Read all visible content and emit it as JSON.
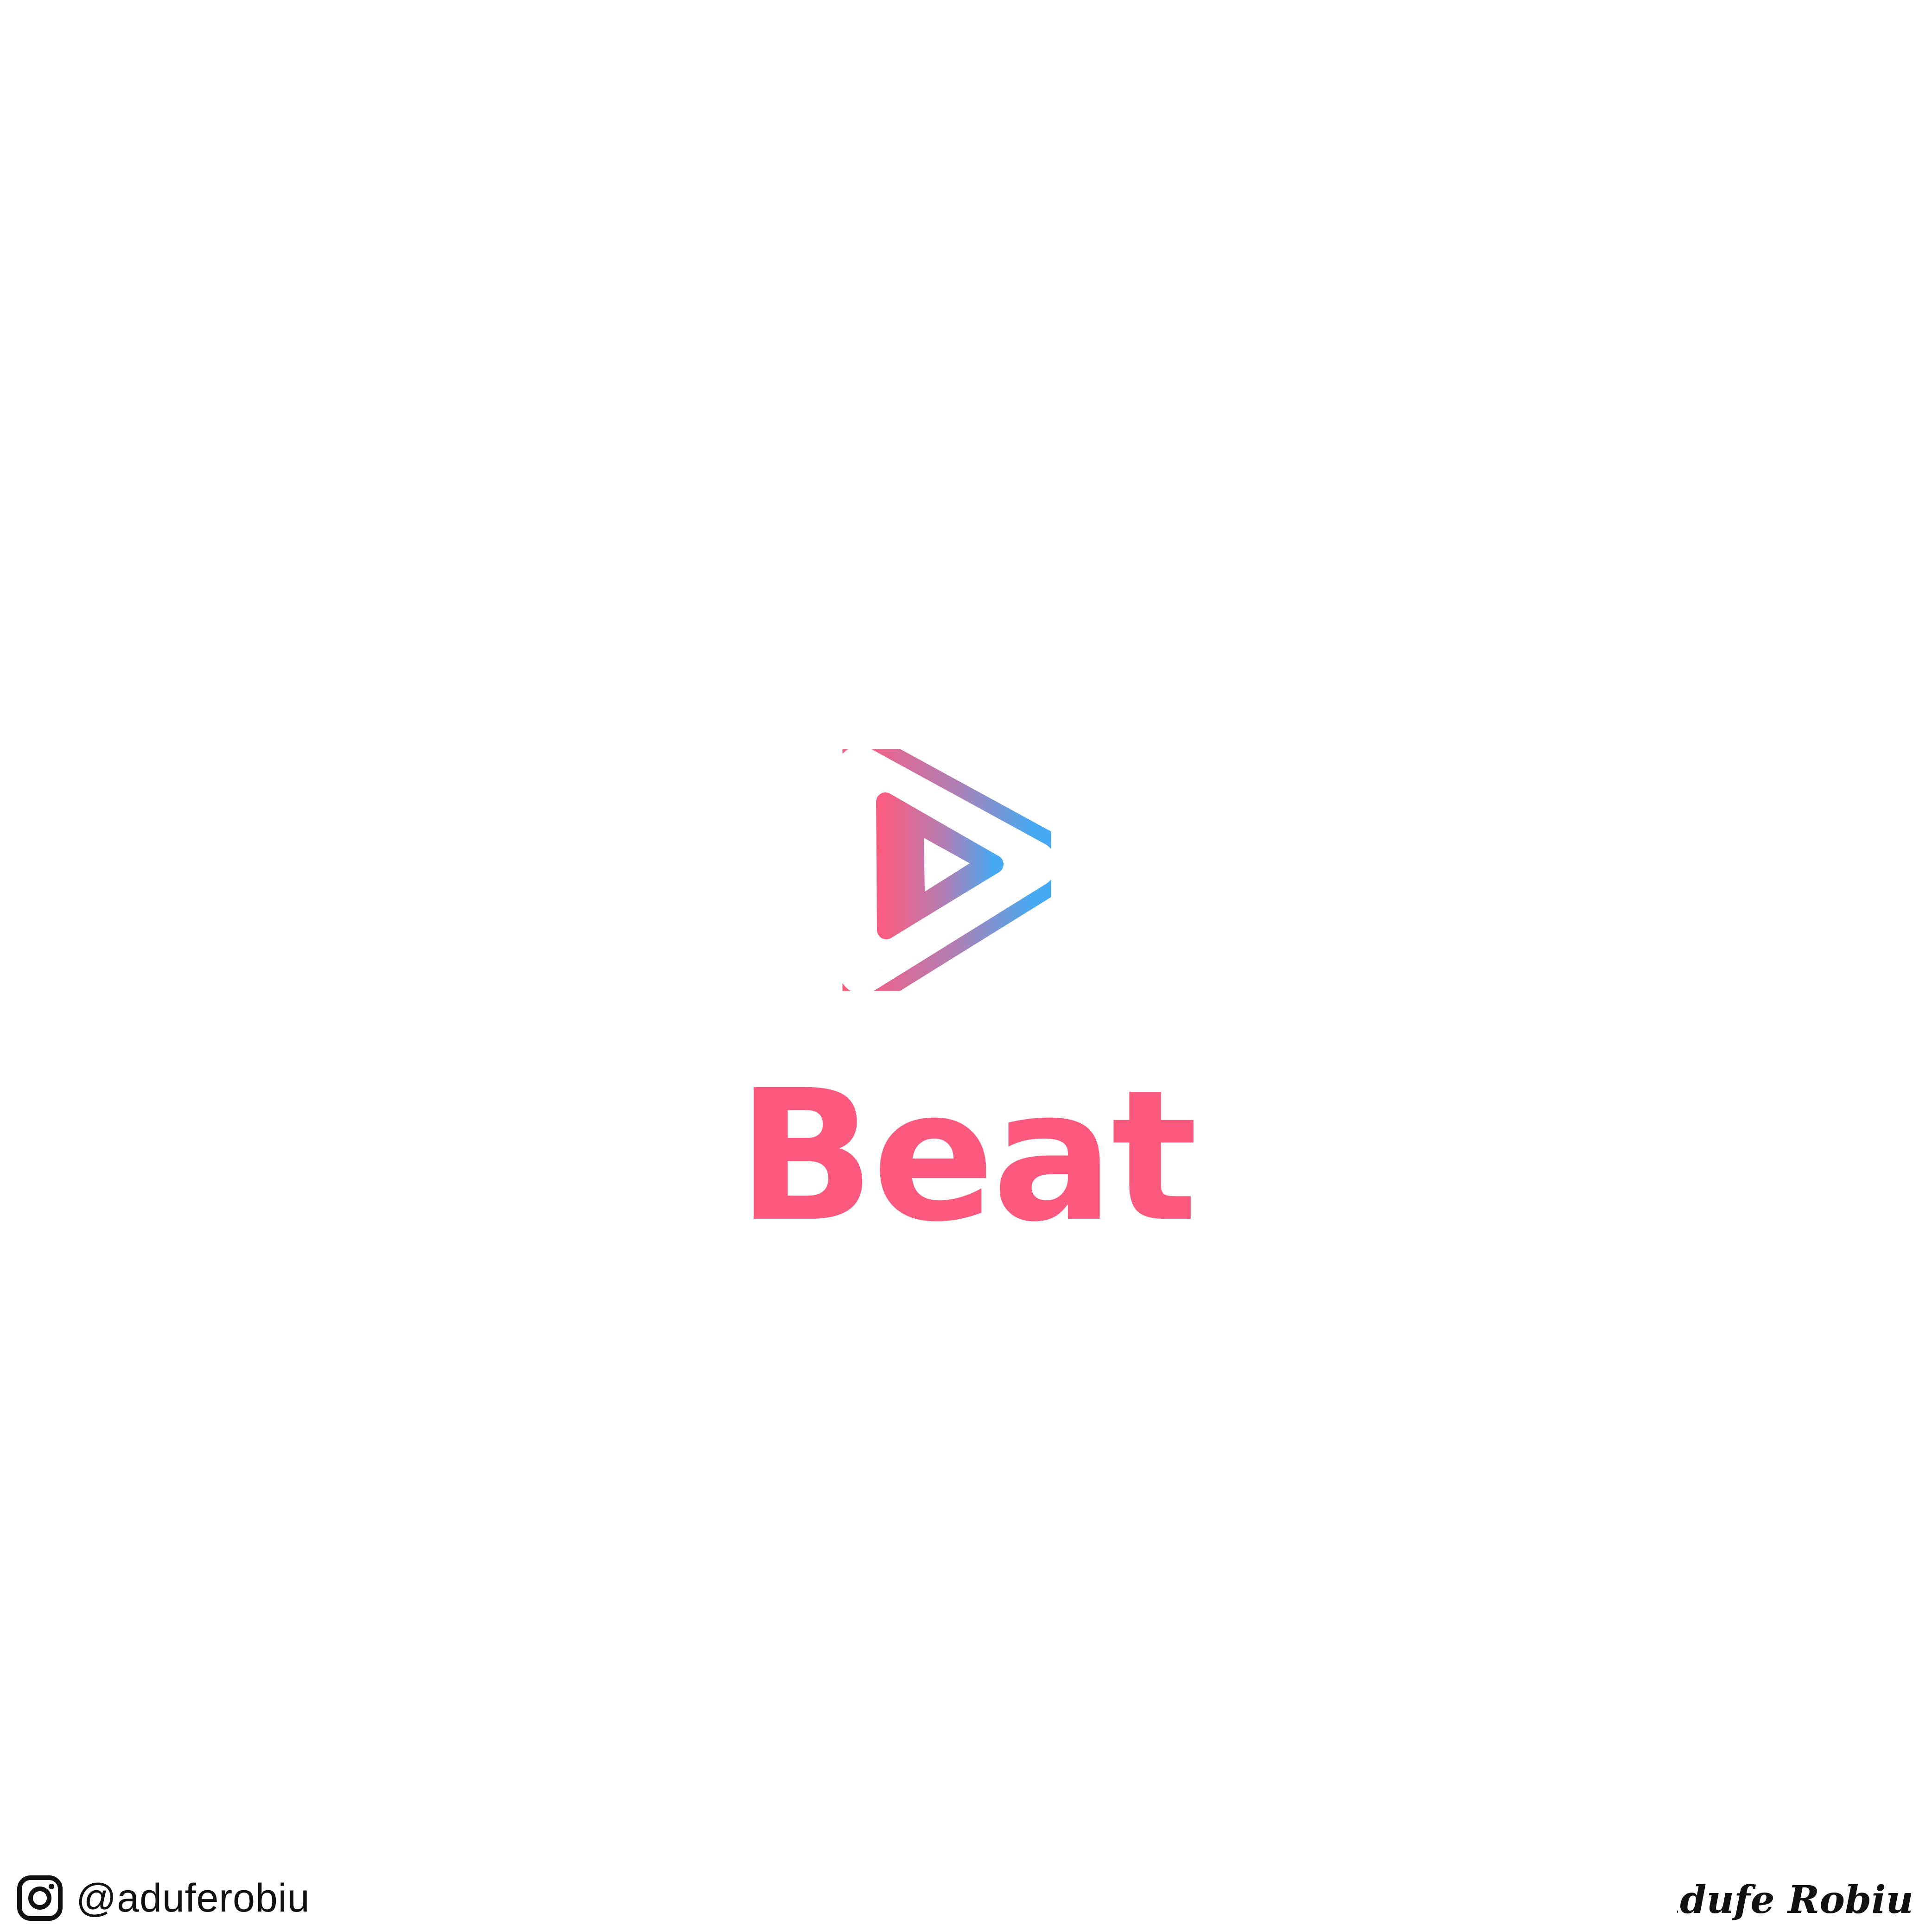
{
  "brand": {
    "name": "Beat",
    "wordmark_color": "#FB5A7E",
    "gradient_start": "#F85C80",
    "gradient_end": "#45AAF2"
  },
  "footer": {
    "instagram_icon": "instagram-icon",
    "handle": "@aduferobiu",
    "signature": "Adufe Robiu"
  }
}
